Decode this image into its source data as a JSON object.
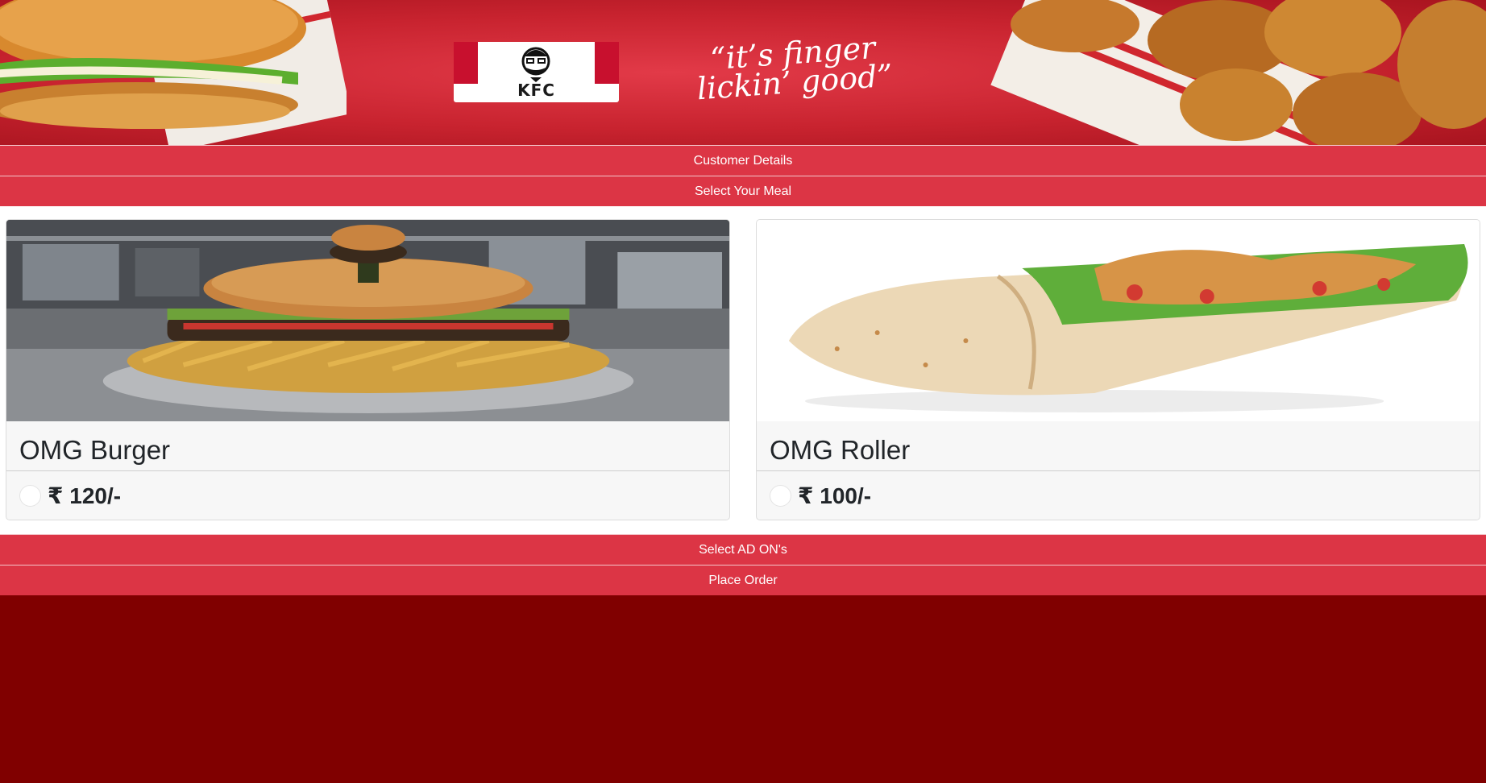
{
  "banner": {
    "brand": "KFC",
    "slogan_line1": "“it’s finger",
    "slogan_line2": "lickin’ good”"
  },
  "sections": {
    "customer_details": "Customer Details",
    "select_meal": "Select Your Meal",
    "select_addons": "Select AD ON's",
    "place_order": "Place Order"
  },
  "meals": [
    {
      "name": "OMG Burger",
      "price": "₹ 120/-",
      "selected": false
    },
    {
      "name": "OMG Roller",
      "price": "₹ 100/-",
      "selected": false
    }
  ],
  "colors": {
    "accent": "#dc3545",
    "page_background": "#800000",
    "card_background": "#f7f7f7"
  }
}
